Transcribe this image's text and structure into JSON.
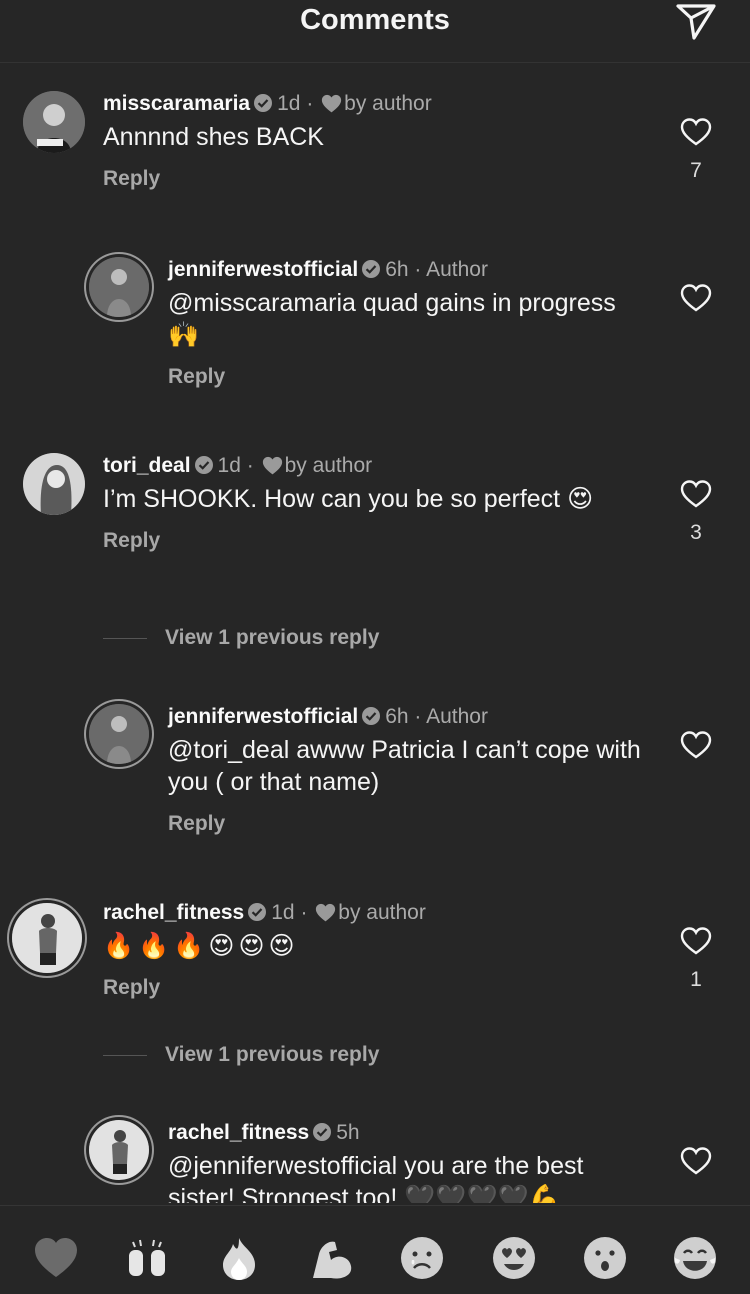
{
  "header": {
    "title": "Comments",
    "send_icon": "paper-plane-icon"
  },
  "comments": [
    {
      "username": "misscaramaria",
      "time": "1d",
      "liked_by": "by author",
      "text": "Annnnd shes BACK",
      "reply_label": "Reply",
      "likes": "7"
    },
    {
      "username": "jenniferwestofficial",
      "time": "6h",
      "badge": "Author",
      "text": "@misscaramaria quad gains in progress 🙌",
      "reply_label": "Reply"
    },
    {
      "username": "tori_deal",
      "time": "1d",
      "liked_by": "by author",
      "text": "I’m SHOOKK. How can you be so perfect 😍",
      "reply_label": "Reply",
      "likes": "3",
      "view_replies": "View 1 previous reply"
    },
    {
      "username": "jenniferwestofficial",
      "time": "6h",
      "badge": "Author",
      "text": "@tori_deal awww Patricia I can’t cope with you ( or that name)",
      "reply_label": "Reply"
    },
    {
      "username": "rachel_fitness",
      "time": "1d",
      "liked_by": "by author",
      "text": "🔥🔥🔥😍😍😍",
      "reply_label": "Reply",
      "likes": "1",
      "view_replies": "View 1 previous reply"
    },
    {
      "username": "rachel_fitness",
      "time": "5h",
      "text": "@jenniferwestofficial you are the best sister! Strongest too! 🖤🖤🖤🖤💪"
    }
  ],
  "sep": " · ",
  "quick_reactions": [
    "🖤",
    "🙌",
    "🔥",
    "💪",
    "😢",
    "😍",
    "😮",
    "😂"
  ],
  "colors": {
    "background": "#262626",
    "text": "#f5f5f5",
    "muted": "#a8a8a8"
  }
}
